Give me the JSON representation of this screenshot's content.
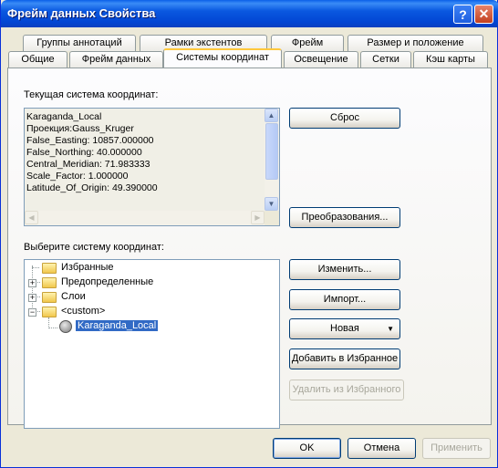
{
  "window": {
    "title": "Фрейм данных Свойства",
    "help_glyph": "?",
    "close_glyph": "✕"
  },
  "tabs": {
    "row_back": [
      "Группы аннотаций",
      "Рамки экстентов",
      "Фрейм",
      "Размер и положение"
    ],
    "row_front": [
      "Общие",
      "Фрейм данных",
      "Системы координат",
      "Освещение",
      "Сетки",
      "Кэш карты"
    ],
    "active": "Системы координат"
  },
  "current": {
    "label": "Текущая система координат:",
    "lines": [
      "Karaganda_Local",
      "Проекция:Gauss_Kruger",
      "False_Easting: 10857.000000",
      "False_Northing: 40.000000",
      "Central_Meridian: 71.983333",
      "Scale_Factor: 1.000000",
      "Latitude_Of_Origin: 49.390000"
    ]
  },
  "buttons": {
    "reset": "Сброс",
    "transform": "Преобразования...",
    "modify": "Изменить...",
    "import": "Импорт...",
    "new": "Новая",
    "add_fav": "Добавить в Избранное",
    "remove_fav": "Удалить из Избранного",
    "ok": "OK",
    "cancel": "Отмена",
    "apply": "Применить"
  },
  "select": {
    "label": "Выберите систему координат:",
    "tree": [
      "Избранные",
      "Предопределенные",
      "Слои",
      "<custom>",
      "Karaganda_Local"
    ]
  }
}
